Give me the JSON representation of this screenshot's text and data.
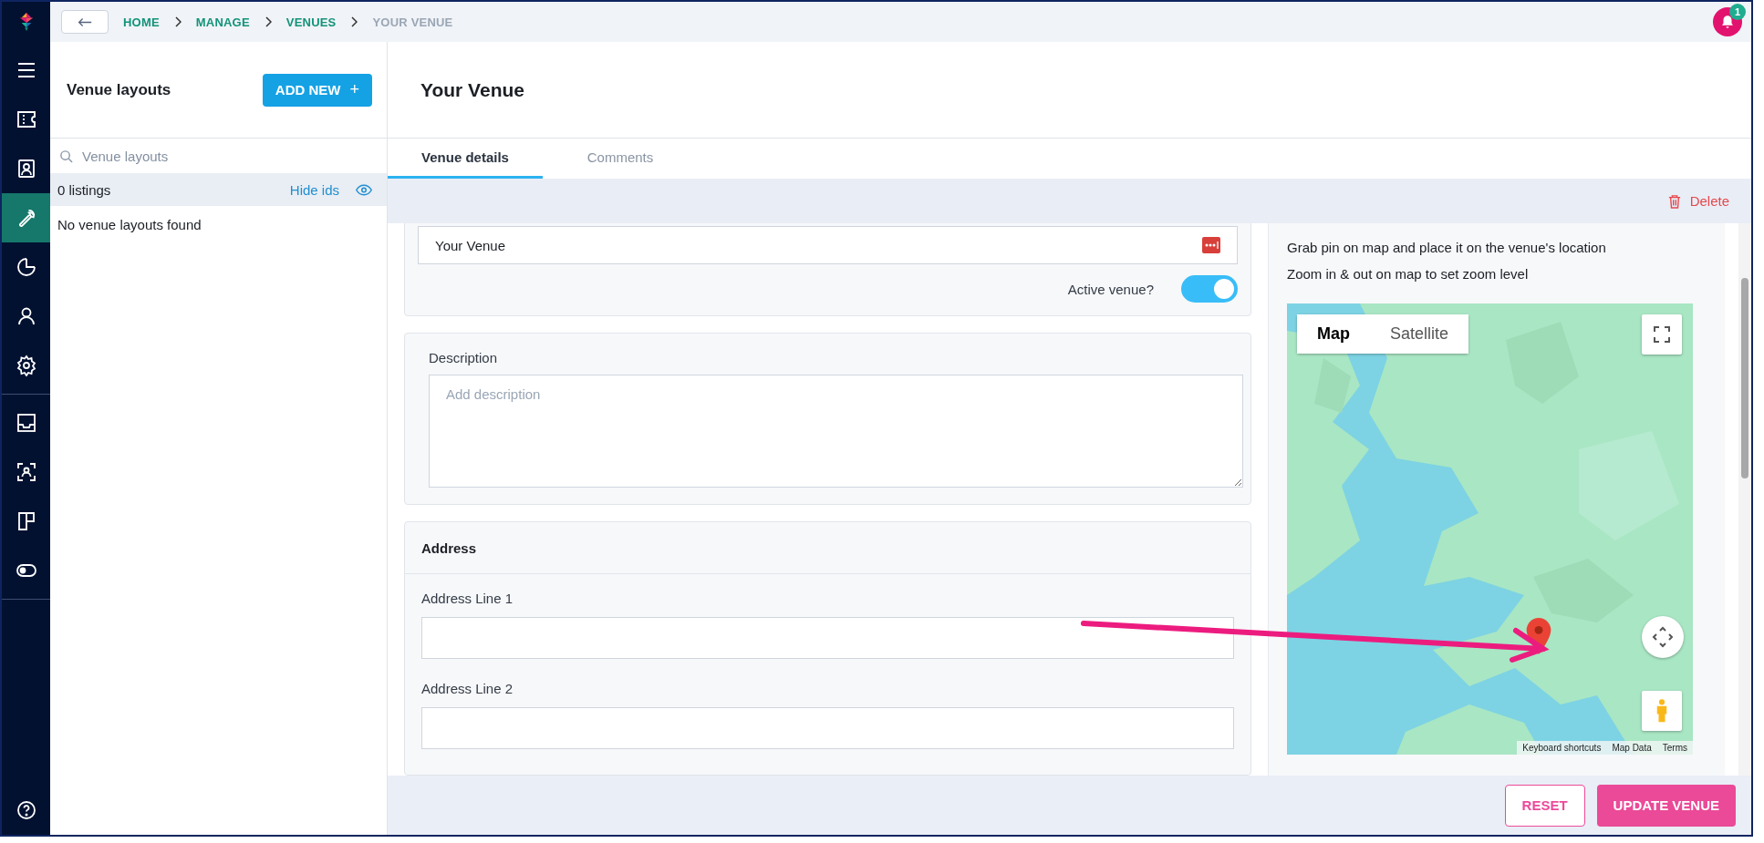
{
  "nav_items": [
    {
      "kind": "menu",
      "selected": false
    },
    {
      "kind": "ticket",
      "selected": false
    },
    {
      "kind": "contact",
      "selected": false
    },
    {
      "kind": "wrench",
      "selected": true
    },
    {
      "kind": "pie",
      "selected": false
    },
    {
      "kind": "person",
      "selected": false
    },
    {
      "kind": "gear",
      "selected": false,
      "divider_after": true
    },
    {
      "kind": "inbox",
      "selected": false
    },
    {
      "kind": "scan",
      "selected": false
    },
    {
      "kind": "board",
      "selected": false
    },
    {
      "kind": "toggle",
      "selected": false,
      "divider_after": true
    }
  ],
  "breadcrumb": [
    {
      "label": "HOME",
      "current": false
    },
    {
      "label": "MANAGE",
      "current": false
    },
    {
      "label": "VENUES",
      "current": false
    },
    {
      "label": "YOUR VENUE",
      "current": true
    }
  ],
  "notifications": {
    "count": "1"
  },
  "layouts_panel": {
    "title": "Venue layouts",
    "add_button": "ADD NEW",
    "add_icon": "+",
    "search": {
      "placeholder": "Venue layouts"
    },
    "count": "0 listings",
    "hide_ids": "Hide ids",
    "empty": "No venue layouts found"
  },
  "venue": {
    "title": "Your Venue",
    "tabs": [
      {
        "label": "Venue details",
        "selected": true
      },
      {
        "label": "Comments",
        "selected": false
      }
    ],
    "delete": "Delete",
    "name_field": {
      "value": "Your Venue"
    },
    "active": {
      "label": "Active venue?",
      "on": true
    },
    "description": {
      "label": "Description",
      "placeholder": "Add description"
    },
    "address": {
      "title": "Address",
      "fields": [
        {
          "label": "Address Line 1"
        },
        {
          "label": "Address Line 2"
        }
      ]
    },
    "map": {
      "hints": [
        "Grab pin on map and place it on the venue's location",
        "Zoom in & out on map to set zoom level"
      ],
      "map_types": [
        {
          "label": "Map",
          "selected": true
        },
        {
          "label": "Satellite",
          "selected": false
        }
      ],
      "footer_links": [
        "Keyboard shortcuts",
        "Map Data",
        "Terms"
      ]
    }
  },
  "actions": {
    "reset": "RESET",
    "update": "UPDATE VENUE"
  }
}
